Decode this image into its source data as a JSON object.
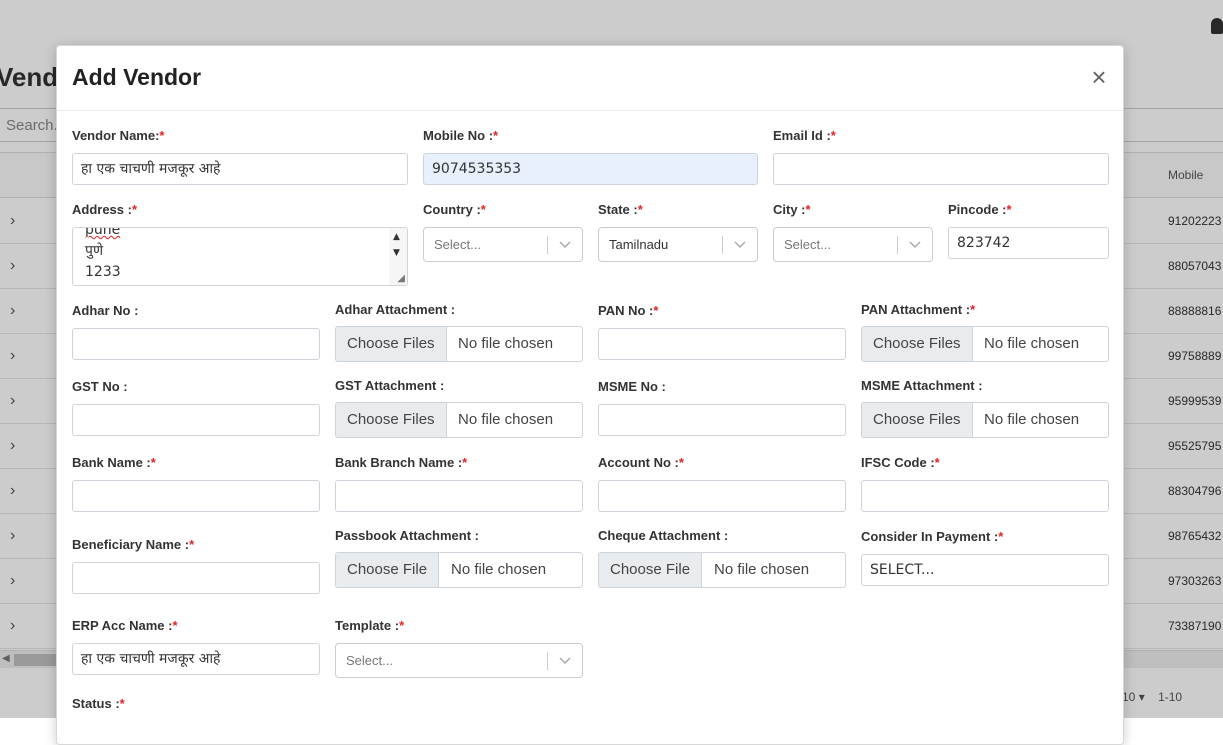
{
  "background": {
    "page_title_partial": "Vend",
    "search_placeholder": "Search..",
    "column_header": "Mobile",
    "mobile_values": [
      "91202223",
      "88057043",
      "88888816",
      "99758889",
      "95999539",
      "95525795",
      "88304796",
      "98765432",
      "97303263",
      "73387190"
    ],
    "pager_size": "10",
    "pager_range": "1-10"
  },
  "modal": {
    "title": "Add Vendor",
    "close_symbol": "×",
    "fields": {
      "vendor_name": {
        "label": "Vendor Name:",
        "required": "*",
        "value": "हा एक चाचणी मजकूर आहे"
      },
      "mobile_no": {
        "label": "Mobile No :",
        "required": "*",
        "value": "9074535353"
      },
      "email_id": {
        "label": "Email Id :",
        "required": "*",
        "value": ""
      },
      "address": {
        "label": "Address :",
        "required": "*",
        "lines": [
          "pune",
          "पुणे",
          "1233"
        ]
      },
      "country": {
        "label": "Country :",
        "required": "*",
        "placeholder": "Select..."
      },
      "state": {
        "label": "State :",
        "required": "*",
        "value": "Tamilnadu"
      },
      "city": {
        "label": "City :",
        "required": "*",
        "placeholder": "Select..."
      },
      "pincode": {
        "label": "Pincode :",
        "required": "*",
        "value": "823742"
      },
      "adhar_no": {
        "label": "Adhar No :",
        "value": ""
      },
      "adhar_attachment": {
        "label": "Adhar Attachment :",
        "button": "Choose Files",
        "status": "No file chosen"
      },
      "pan_no": {
        "label": "PAN No :",
        "required": "*",
        "value": ""
      },
      "pan_attachment": {
        "label": "PAN Attachment :",
        "required": "*",
        "button": "Choose Files",
        "status": "No file chosen"
      },
      "gst_no": {
        "label": "GST No :",
        "value": ""
      },
      "gst_attachment": {
        "label": "GST Attachment :",
        "button": "Choose Files",
        "status": "No file chosen"
      },
      "msme_no": {
        "label": "MSME No :",
        "value": ""
      },
      "msme_attachment": {
        "label": "MSME Attachment :",
        "button": "Choose Files",
        "status": "No file chosen"
      },
      "bank_name": {
        "label": "Bank Name :",
        "required": "*",
        "value": ""
      },
      "bank_branch_name": {
        "label": "Bank Branch Name :",
        "required": "*",
        "value": ""
      },
      "account_no": {
        "label": "Account No :",
        "required": "*",
        "value": ""
      },
      "ifsc_code": {
        "label": "IFSC Code :",
        "required": "*",
        "value": ""
      },
      "beneficiary_name": {
        "label": "Beneficiary Name :",
        "required": "*",
        "value": ""
      },
      "passbook_attachment": {
        "label": "Passbook Attachment :",
        "button": "Choose File",
        "status": "No file chosen"
      },
      "cheque_attachment": {
        "label": "Cheque Attachment :",
        "button": "Choose File",
        "status": "No file chosen"
      },
      "consider_in_payment": {
        "label": "Consider In Payment :",
        "required": "*",
        "value": "SELECT..."
      },
      "erp_acc_name": {
        "label": "ERP Acc Name :",
        "required": "*",
        "value": "हा एक चाचणी मजकूर आहे"
      },
      "template": {
        "label": "Template :",
        "required": "*",
        "placeholder": "Select..."
      },
      "status": {
        "label": "Status :",
        "required": "*"
      }
    }
  },
  "icons": {
    "close": "close-icon",
    "chevron": "chevron-down-icon",
    "bell": "bell-icon",
    "expand": "chevron-right-icon"
  }
}
